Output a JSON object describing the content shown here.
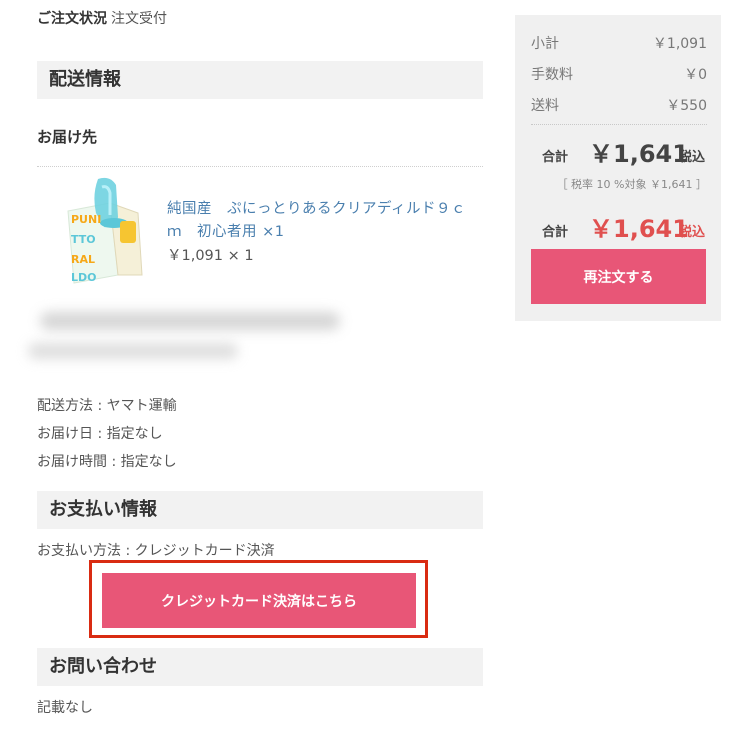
{
  "order_status": {
    "label": "ご注文状況",
    "value": "注文受付"
  },
  "shipping": {
    "section_title": "配送情報",
    "destination_label": "お届け先",
    "product": {
      "name": "純国産　ぷにっとりあるクリアディルド９ｃｍ　初心者用 ×1",
      "price_line": "￥1,091 × 1",
      "image_icon": "product-box-image"
    },
    "method": "配送方法 : ヤマト運輸",
    "date": "お届け日 : 指定なし",
    "time": "お届け時間 : 指定なし"
  },
  "payment": {
    "section_title": "お支払い情報",
    "method": "お支払い方法 : クレジットカード決済",
    "button_label": "クレジットカード決済はこちら"
  },
  "contact": {
    "section_title": "お問い合わせ",
    "value": "記載なし"
  },
  "summary": {
    "subtotal_label": "小計",
    "subtotal_value": "￥1,091",
    "fee_label": "手数料",
    "fee_value": "￥0",
    "shipping_label": "送料",
    "shipping_value": "￥550",
    "total_label": "合計",
    "total_value": "￥1,641",
    "tax_in": "税込",
    "tax_note": "［ 税率 10 %対象  ￥1,641 ］",
    "grand_label": "合計",
    "grand_value": "￥1,641",
    "grand_tax_in": "税込",
    "reorder_label": "再注文する"
  },
  "colors": {
    "accent": "#e85677",
    "grand_total": "#e0504f",
    "highlight_frame": "#d92b12",
    "link": "#4a7fae"
  }
}
